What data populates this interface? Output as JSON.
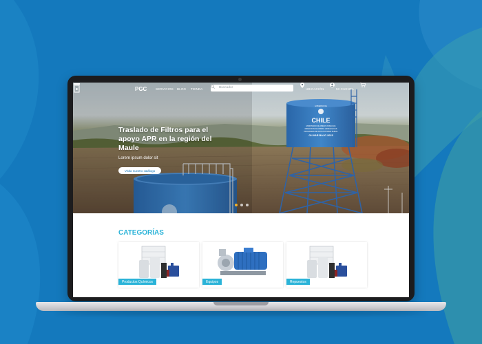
{
  "theme": {
    "accent": "#2ab3d8",
    "brand_blue": "#1479bd",
    "dot_active": "#f2b12b"
  },
  "header": {
    "logo_text": "PGC",
    "nav": [
      "SERVICIOS",
      "BLOG",
      "TIENDA"
    ],
    "search_placeholder": "Buscador",
    "location_label": "UBICACIÓN",
    "account_label": "MI CUENTA",
    "cart_icon": "cart-icon"
  },
  "hero": {
    "title": "Traslado de Filtros para el apoyo APR en la región del Maule",
    "subtitle": "Lorem ipsum dolor sit",
    "button_label": "Visita nuestro catálogo",
    "tank_sign": {
      "line1": "GOBIERNO DE",
      "line2": "CHILE",
      "line3": "MINISTERIO DE OBRAS PUBLICAS",
      "line4": "DIRECCION DE OBRAS HIDRAULICAS",
      "line5": "PROGRAMA DE AGUA POTABLE RURAL",
      "line6": "OLIVAR BAJO 2015"
    },
    "slides": 3,
    "active_slide": 1
  },
  "categories": {
    "title": "CATEGORÍAS",
    "items": [
      {
        "label": "Productos Químicos"
      },
      {
        "label": "Equipos"
      },
      {
        "label": "Repuestos"
      }
    ]
  }
}
